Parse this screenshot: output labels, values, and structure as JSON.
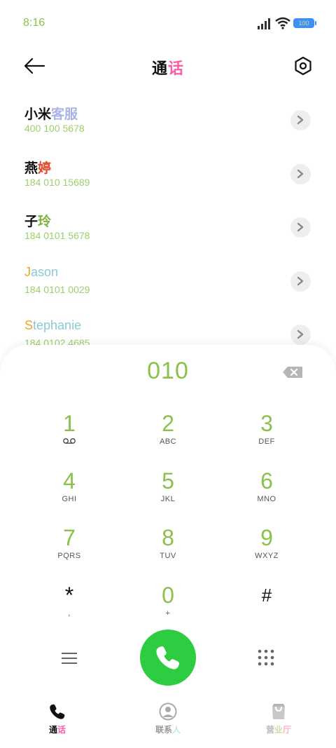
{
  "status_bar": {
    "time": "8:16",
    "battery": "100",
    "icons": [
      "signal-icon",
      "wifi-icon",
      "battery-icon"
    ]
  },
  "header": {
    "back_icon": "back-arrow-icon",
    "title_part1": "通",
    "title_part2": "话",
    "settings_icon": "settings-hexagon-icon"
  },
  "contacts": [
    {
      "name_a": "小米",
      "name_b": "客服",
      "phone": "400 100 5678"
    },
    {
      "name_a": "燕",
      "name_b": "婷",
      "phone": "184 010 15689"
    },
    {
      "name_a": "子",
      "name_b": "玲",
      "phone": "184 0101 5678"
    },
    {
      "name_a": "J",
      "name_b": "ason",
      "phone": "184 0101 0029"
    },
    {
      "name_a": "S",
      "name_b": "tephanie",
      "phone": "184 0102 4685"
    }
  ],
  "dialer": {
    "input_value": "010",
    "backspace_icon": "backspace-icon",
    "keys": [
      {
        "digit": "1",
        "sub": ""
      },
      {
        "digit": "2",
        "sub": "ABC"
      },
      {
        "digit": "3",
        "sub": "DEF"
      },
      {
        "digit": "4",
        "sub": "GHI"
      },
      {
        "digit": "5",
        "sub": "JKL"
      },
      {
        "digit": "6",
        "sub": "MNO"
      },
      {
        "digit": "7",
        "sub": "PQRS"
      },
      {
        "digit": "8",
        "sub": "TUV"
      },
      {
        "digit": "9",
        "sub": "WXYZ"
      },
      {
        "digit": "*",
        "sub": ","
      },
      {
        "digit": "0",
        "sub": "+"
      },
      {
        "digit": "#",
        "sub": ""
      }
    ],
    "menu_icon": "menu-icon",
    "call_icon": "phone-icon",
    "keypad_icon": "keypad-grid-icon"
  },
  "bottom_nav": [
    {
      "label_a": "通",
      "label_b": "话",
      "icon": "phone-icon",
      "active": true
    },
    {
      "label_a": "联系",
      "label_b": "人",
      "icon": "contact-icon",
      "active": false
    },
    {
      "label_a": "营",
      "label_b": "业",
      "label_c": "厅",
      "icon": "store-bag-icon",
      "active": false
    }
  ],
  "colors": {
    "accent_green": "#8cc04e",
    "call_green": "#2ecc40",
    "pink": "#ff5ca8"
  }
}
